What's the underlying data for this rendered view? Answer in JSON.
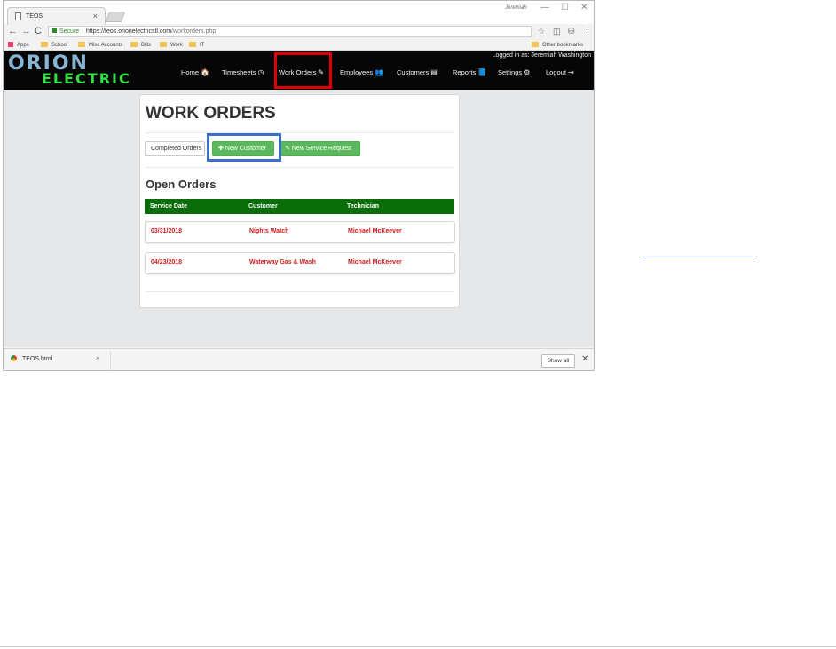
{
  "browser": {
    "tab_title": "TEOS",
    "tab_close": "×",
    "user_name": "Jeremiah",
    "window_controls": [
      "—",
      "☐",
      "✕"
    ],
    "nav_glyphs": [
      "←",
      "→",
      "C"
    ],
    "secure_label": "Secure",
    "url_host": "https://teos.orionelectricstl.com",
    "url_path": "/workorders.php",
    "toolbar_icons": [
      "☆",
      "◫",
      "⛁",
      "⋮"
    ],
    "bookmarks": [
      "Apps",
      "School",
      "Misc Accounts",
      "Bills",
      "Work",
      "IT"
    ],
    "other_bookmarks": "Other bookmarks"
  },
  "site": {
    "logo_top": "ORION",
    "logo_bottom": "ELECTRIC",
    "logged_in": "Logged in as: Jeremiah Washington",
    "nav": [
      {
        "label": "Home",
        "icon": "🏠",
        "icon_name": "home-icon"
      },
      {
        "label": "Timesheets",
        "icon": "◷",
        "icon_name": "clock-icon"
      },
      {
        "label": "Work Orders",
        "icon": "✎",
        "icon_name": "edit-icon"
      },
      {
        "label": "Employees",
        "icon": "👥",
        "icon_name": "users-icon"
      },
      {
        "label": "Customers",
        "icon": "▤",
        "icon_name": "card-icon"
      },
      {
        "label": "Reports",
        "icon": "📘",
        "icon_name": "book-icon"
      },
      {
        "label": "Settings",
        "icon": "⚙",
        "icon_name": "cogs-icon"
      },
      {
        "label": "Logout",
        "icon": "⇥",
        "icon_name": "logout-icon"
      }
    ],
    "highlight_colors": {
      "red": "#e00000",
      "blue": "#3c6ecb"
    }
  },
  "page": {
    "title": "WORK ORDERS",
    "buttons": {
      "completed": "Completed Orders",
      "new_customer": "New Customer",
      "new_service": "New Service Request"
    },
    "section": "Open Orders",
    "columns": [
      "Service Date",
      "Customer",
      "Technician"
    ],
    "rows": [
      {
        "date": "03/31/2018",
        "customer": "Nights Watch",
        "tech": "Michael McKeever"
      },
      {
        "date": "04/23/2018",
        "customer": "Waterway Gas & Wash",
        "tech": "Michael McKeever"
      }
    ]
  },
  "downloads": {
    "file": "TEOS.html",
    "chevron": "^",
    "show_all": "Show all",
    "close": "✕"
  }
}
